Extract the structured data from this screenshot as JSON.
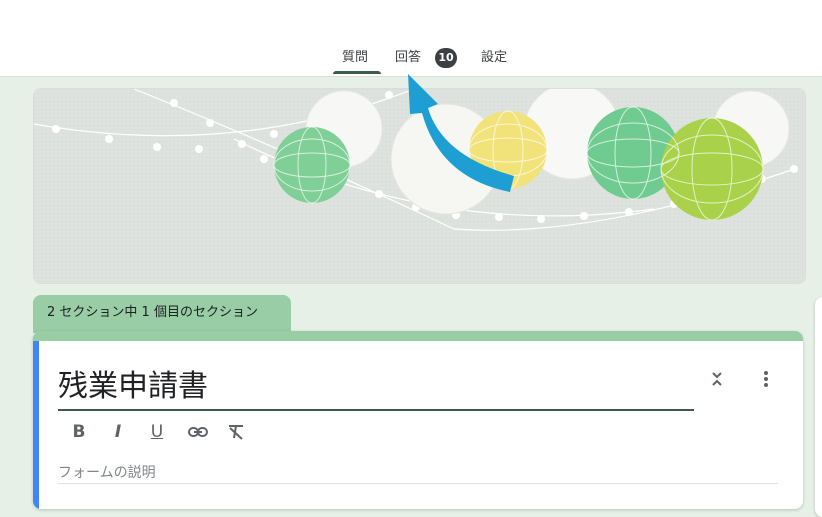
{
  "tabs": [
    {
      "label": "質問"
    },
    {
      "label": "回答"
    },
    {
      "label": "設定"
    }
  ],
  "responses_badge": "10",
  "section_label": "2 セクション中 1 個目のセクション",
  "form": {
    "title": "残業申請書",
    "description_placeholder": "フォームの説明"
  },
  "toolbar": {
    "bold": "B",
    "italic": "I",
    "underline": "U"
  },
  "colors": {
    "accent": "#3d5c4a",
    "section_tab": "#98cda6",
    "card_left_border": "#4285f4",
    "background": "#e6f0e7",
    "arrow": "#1e9fd4"
  },
  "icons": [
    "collapse-icon",
    "more-vert-icon",
    "bold-icon",
    "italic-icon",
    "underline-icon",
    "link-icon",
    "clear-format-icon",
    "arrow-annotation"
  ]
}
